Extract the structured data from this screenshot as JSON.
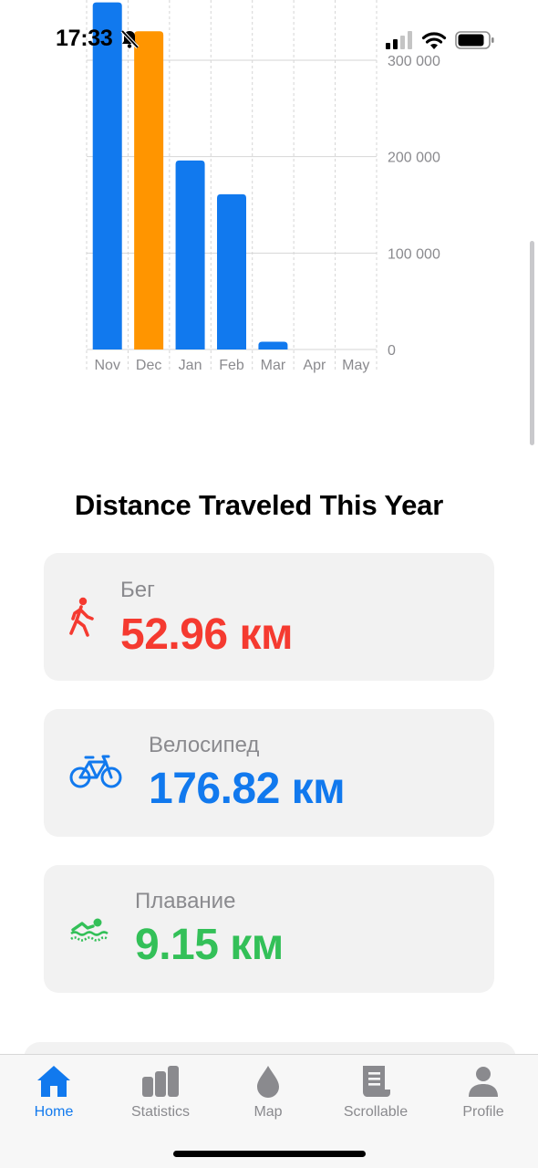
{
  "status_bar": {
    "time": "17:33",
    "icons": [
      "bell-slash-icon",
      "cellular-signal-icon",
      "wifi-icon",
      "battery-icon"
    ]
  },
  "chart_data": {
    "type": "bar",
    "categories": [
      "Nov",
      "Dec",
      "Jan",
      "Feb",
      "Mar",
      "Apr",
      "May"
    ],
    "values": [
      360000,
      330000,
      196000,
      161000,
      8000,
      0,
      0
    ],
    "highlighted_category": "Dec",
    "colors": {
      "default": "#1179ee",
      "highlight": "#ff9500"
    },
    "ylim": [
      0,
      300000
    ],
    "yticks": [
      {
        "value": 0,
        "label": "0"
      },
      {
        "value": 100000,
        "label": "100 000"
      },
      {
        "value": 200000,
        "label": "200 000"
      },
      {
        "value": 300000,
        "label": "300 000"
      }
    ],
    "y_axis_position": "right",
    "grid": true
  },
  "section_title": "Distance Traveled This Year",
  "cards": {
    "run": {
      "icon": "walking-figure-icon",
      "label": "Бег",
      "value": "52.96 км",
      "color": "#f53a30"
    },
    "bike": {
      "icon": "bicycle-icon",
      "label": "Велосипед",
      "value": "176.82 км",
      "color": "#1179ee"
    },
    "swim": {
      "icon": "swimming-icon",
      "label": "Плавание",
      "value": "9.15 км",
      "color": "#33c058"
    }
  },
  "tab_bar": {
    "active": "home",
    "active_color": "#1179ee",
    "inactive_color": "#8a8a8e",
    "tabs": [
      {
        "id": "home",
        "label": "Home",
        "icon": "house-icon"
      },
      {
        "id": "statistics",
        "label": "Statistics",
        "icon": "bar-chart-icon"
      },
      {
        "id": "map",
        "label": "Map",
        "icon": "drop-icon"
      },
      {
        "id": "scrollable",
        "label": "Scrollable",
        "icon": "scroll-icon"
      },
      {
        "id": "profile",
        "label": "Profile",
        "icon": "person-icon"
      }
    ]
  }
}
